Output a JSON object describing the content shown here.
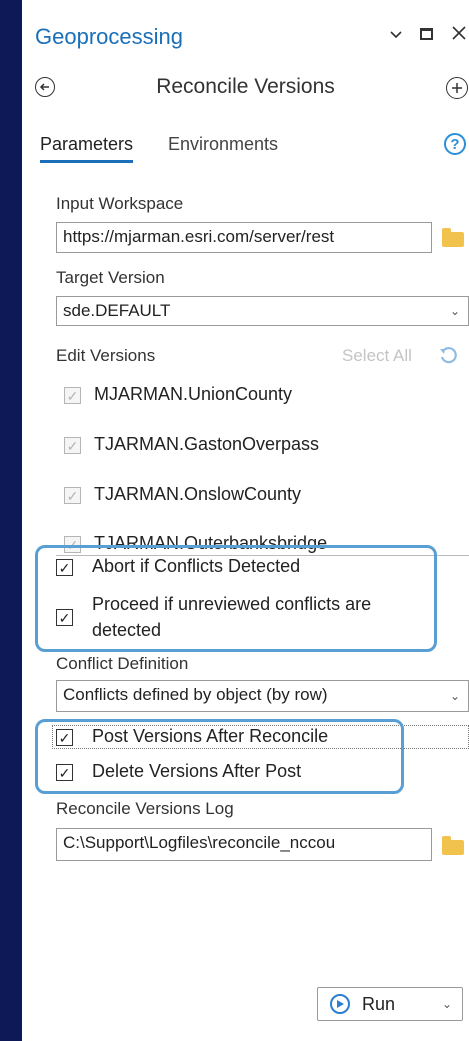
{
  "pane": {
    "title": "Geoprocessing",
    "window_icons": {
      "dropdown": "chevron-down-icon",
      "maximize": "maximize-icon",
      "close": "close-icon"
    }
  },
  "tool": {
    "title": "Reconcile Versions",
    "back_icon": "back-arrow-icon",
    "add_icon": "plus-icon"
  },
  "tabs": [
    {
      "label": "Parameters",
      "active": true
    },
    {
      "label": "Environments",
      "active": false
    }
  ],
  "help_label": "?",
  "params": {
    "input_workspace": {
      "label": "Input Workspace",
      "value": "https://mjarman.esri.com/server/rest"
    },
    "target_version": {
      "label": "Target Version",
      "value": "sde.DEFAULT"
    },
    "edit_versions": {
      "label": "Edit Versions",
      "select_all": "Select All",
      "items": [
        {
          "label": "MJARMAN.UnionCounty",
          "checked": true
        },
        {
          "label": "TJARMAN.GastonOverpass",
          "checked": true
        },
        {
          "label": "TJARMAN.OnslowCounty",
          "checked": true
        },
        {
          "label": "TJARMAN.Outerbanksbridge",
          "checked": true
        }
      ]
    },
    "abort_if_conflicts": {
      "label": "Abort if Conflicts Detected",
      "checked": true
    },
    "proceed_if_unreviewed": {
      "label_line1": "Proceed if unreviewed conflicts are",
      "label_line2": "detected",
      "checked": true
    },
    "conflict_definition": {
      "label": "Conflict Definition",
      "value": "Conflicts defined by object (by row)"
    },
    "post_versions": {
      "label": "Post Versions After Reconcile",
      "checked": true
    },
    "delete_versions": {
      "label": "Delete Versions After Post",
      "checked": true
    },
    "reconcile_log": {
      "label": "Reconcile Versions Log",
      "value": "C:\\Support\\Logfiles\\reconcile_nccou"
    }
  },
  "run_button": {
    "label": "Run"
  },
  "colors": {
    "accent": "#1a6fb8",
    "highlight": "#5a9fd4",
    "frame": "#0e1a57",
    "folder": "#f1c24c"
  }
}
